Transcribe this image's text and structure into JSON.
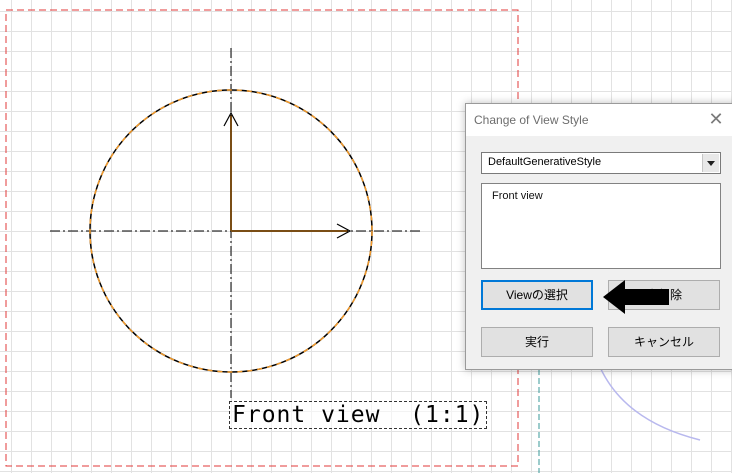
{
  "drawing": {
    "view_label": "Front view  (1:1)"
  },
  "colors": {
    "frame_red": "#e03a3a",
    "circle_orange": "#f39a2a",
    "grid": "#e2e2e2",
    "dialog_bg": "#f0f0f0"
  },
  "dialog": {
    "title": "Change of View Style",
    "close_icon": "close-icon",
    "style_select": {
      "value": "DefaultGenerativeStyle"
    },
    "view_list": {
      "items": [
        "Front view"
      ]
    },
    "buttons": {
      "select_view": "Viewの選択",
      "delete": "全削除",
      "run": "実行",
      "cancel": "キャンセル"
    }
  },
  "annotation": {
    "icon": "arrow-left-icon"
  }
}
